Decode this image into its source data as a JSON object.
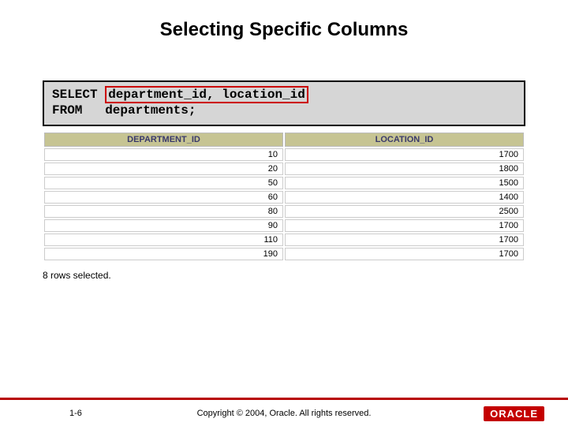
{
  "title": "Selecting Specific Columns",
  "sql": {
    "select_kw": "SELECT",
    "select_cols": "department_id, location_id",
    "from_kw": "FROM",
    "from_table": "departments;"
  },
  "chart_data": {
    "type": "table",
    "title": "",
    "columns": [
      "DEPARTMENT_ID",
      "LOCATION_ID"
    ],
    "rows": [
      [
        10,
        1700
      ],
      [
        20,
        1800
      ],
      [
        50,
        1500
      ],
      [
        60,
        1400
      ],
      [
        80,
        2500
      ],
      [
        90,
        1700
      ],
      [
        110,
        1700
      ],
      [
        190,
        1700
      ]
    ]
  },
  "rows_selected": "8 rows selected.",
  "footer": {
    "page": "1-6",
    "copyright": "Copyright © 2004, Oracle. All rights reserved.",
    "logo": "ORACLE"
  }
}
